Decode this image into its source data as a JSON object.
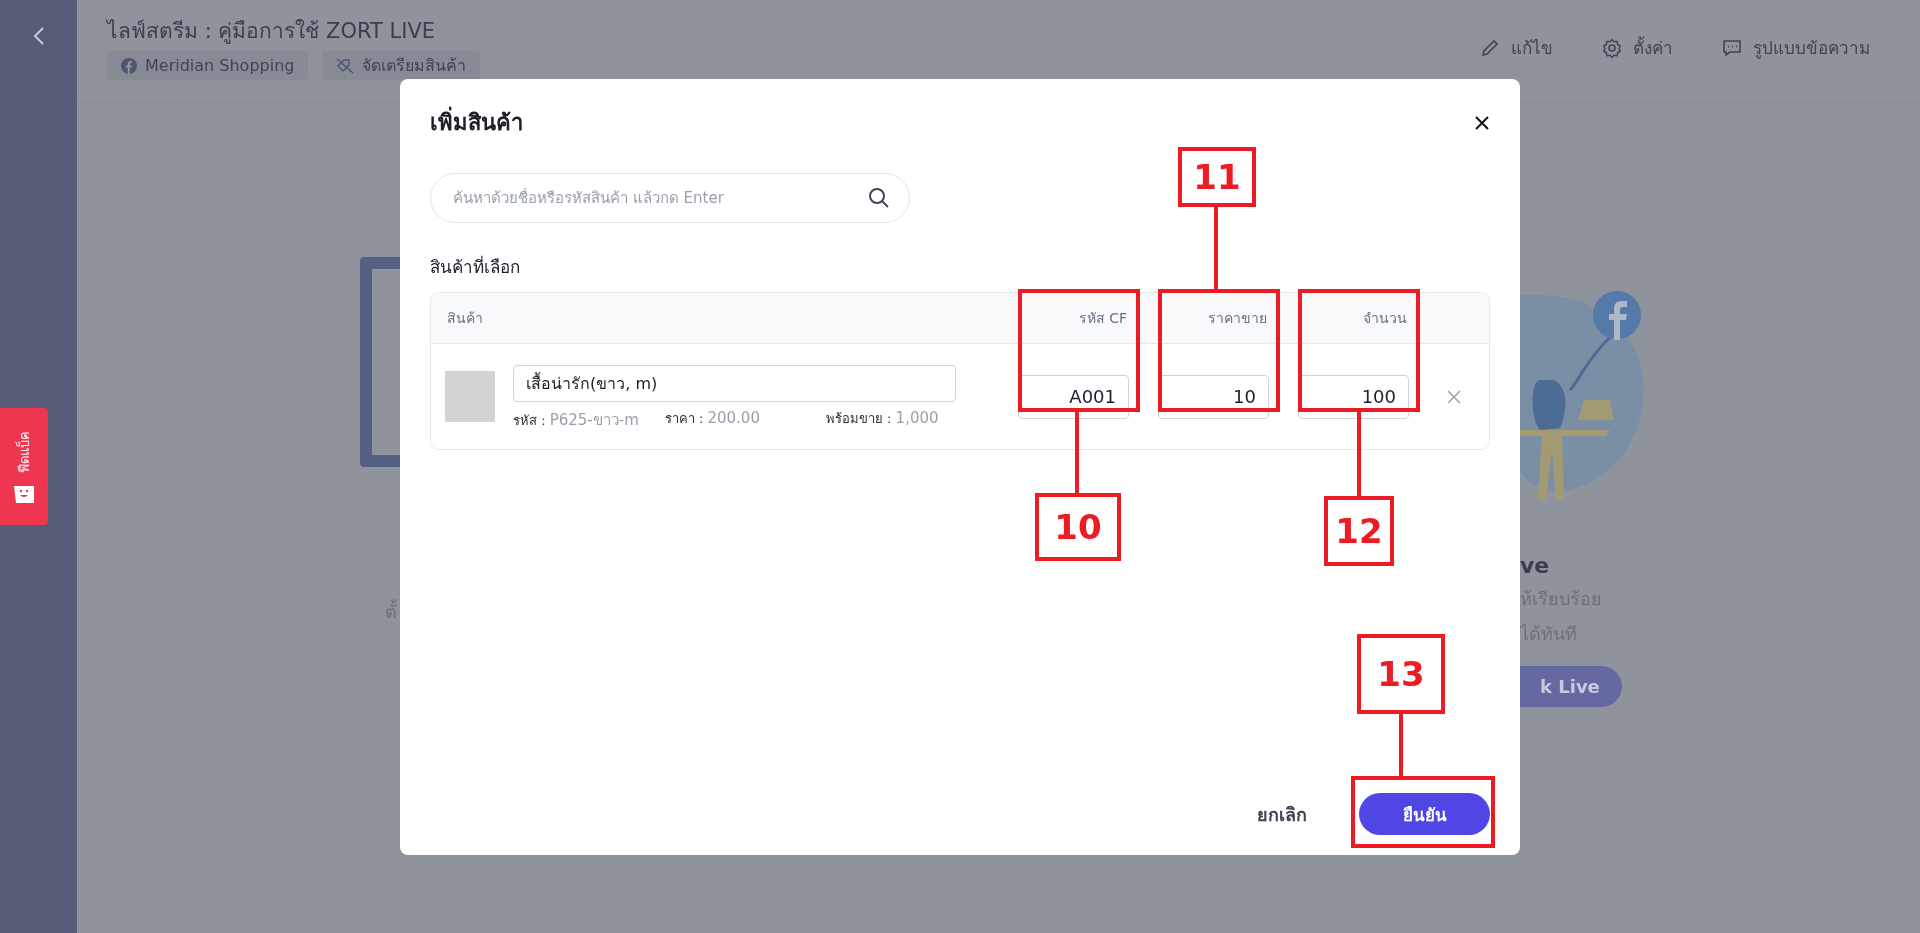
{
  "header": {
    "title": "ไลฟ์สตรีม : คู่มือการใช้ ZORT LIVE",
    "chips": [
      {
        "kind": "facebook",
        "label": "Meridian Shopping"
      },
      {
        "kind": "prepare",
        "label": "จัดเตรียมสินค้า"
      }
    ],
    "actions": [
      {
        "kind": "edit",
        "label": "แก้ไข"
      },
      {
        "kind": "settings",
        "label": "ตั้งค่า"
      },
      {
        "kind": "message",
        "label": "รูปแบบข้อความ"
      }
    ]
  },
  "feedback_tab": {
    "label": "ฟีดแบ็ค"
  },
  "background": {
    "left_text": "ตั้",
    "right_title": "ve",
    "right_lines": [
      "ห้เรียบร้อย",
      "ได้ทันที"
    ],
    "right_button": "k Live"
  },
  "dialog": {
    "title": "เพิ่มสินค้า",
    "search": {
      "placeholder": "ค้นหาด้วยชื่อหรือรหัสสินค้า แล้วกด Enter"
    },
    "section_label": "สินค้าที่เลือก",
    "table": {
      "columns": [
        "สินค้า",
        "รหัส CF",
        "ราคาขาย",
        "จำนวน"
      ],
      "rows": [
        {
          "name": "เสื้อน่ารัก(ขาว, m)",
          "meta": [
            {
              "label": "รหัส :",
              "value": "P625-ขาว-m"
            },
            {
              "label": "ราคา :",
              "value": "200.00"
            },
            {
              "label": "พร้อมขาย :",
              "value": "1,000"
            }
          ],
          "cf_code": "A001",
          "price": "10",
          "quantity": "100"
        }
      ]
    },
    "buttons": [
      {
        "kind": "cancel",
        "label": "ยกเลิก"
      },
      {
        "kind": "confirm",
        "label": "ยืนยัน"
      }
    ]
  },
  "callouts": [
    {
      "label": "10"
    },
    {
      "label": "11"
    },
    {
      "label": "12"
    },
    {
      "label": "13"
    }
  ]
}
